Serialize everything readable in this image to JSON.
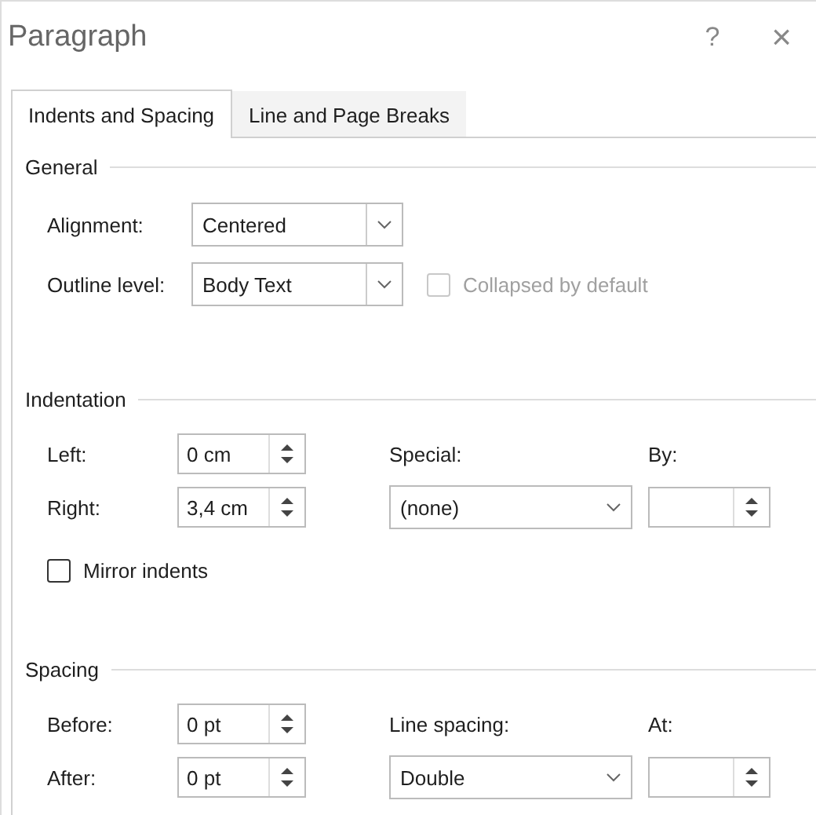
{
  "window": {
    "title": "Paragraph",
    "help": "?",
    "close": "×"
  },
  "tabs": [
    {
      "label": "Indents and Spacing",
      "selected": true
    },
    {
      "label": "Line and Page Breaks",
      "selected": false
    }
  ],
  "general": {
    "heading": "General",
    "alignment": {
      "label": "Alignment:",
      "value": "Centered"
    },
    "outline_level": {
      "label": "Outline level:",
      "value": "Body Text"
    },
    "collapsed": {
      "label": "Collapsed by default",
      "checked": false,
      "disabled": true
    }
  },
  "indentation": {
    "heading": "Indentation",
    "left": {
      "label": "Left:",
      "value": "0 cm"
    },
    "right": {
      "label": "Right:",
      "value": "3,4 cm"
    },
    "special": {
      "label": "Special:",
      "value": "(none)"
    },
    "by": {
      "label": "By:"
    },
    "mirror": {
      "label": "Mirror indents",
      "checked": false,
      "disabled": false
    }
  },
  "spacing": {
    "heading": "Spacing",
    "before": {
      "label": "Before:",
      "value": "0 pt"
    },
    "after": {
      "label": "After:",
      "value": "0 pt"
    },
    "line_spacing": {
      "label": "Line spacing:",
      "value": "Double"
    },
    "at": {
      "label": "At:"
    }
  }
}
